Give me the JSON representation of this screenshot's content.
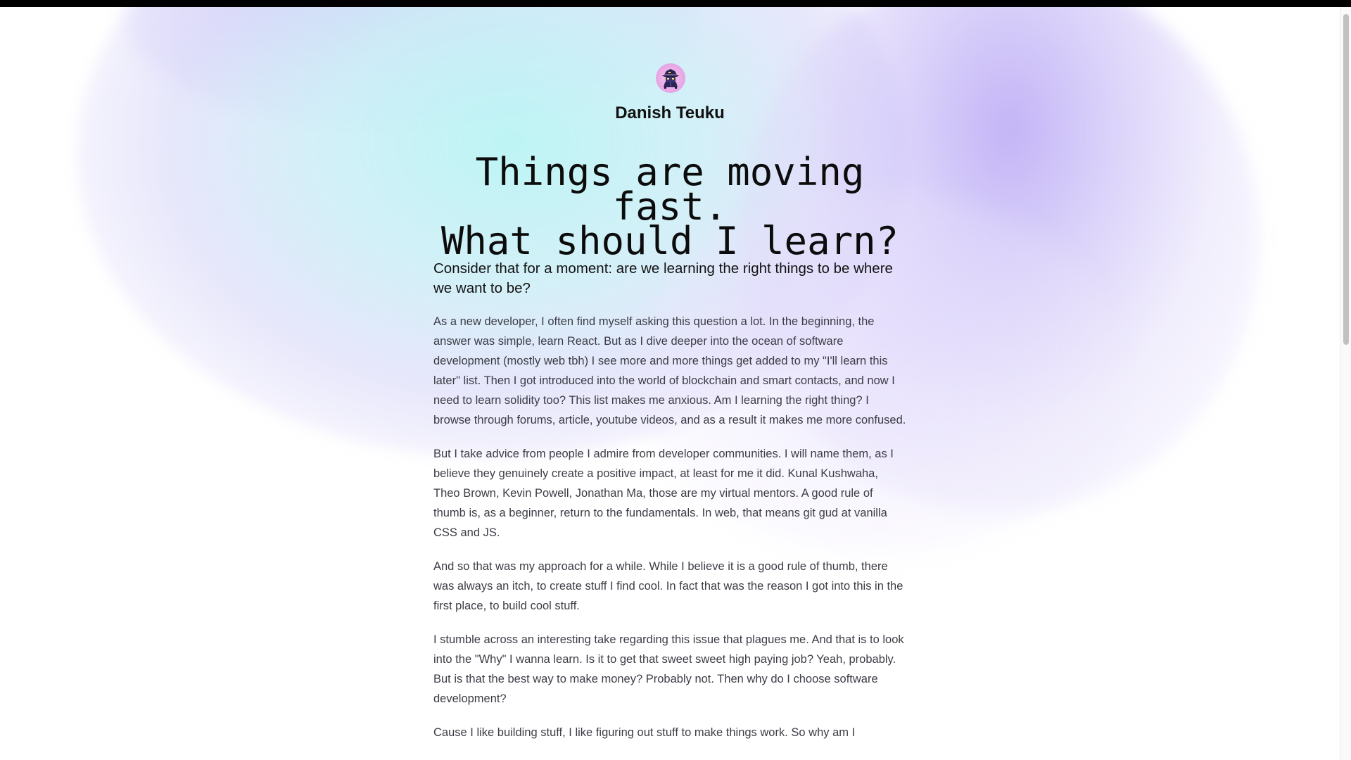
{
  "author": {
    "name": "Danish Teuku",
    "avatar_icon": "wizard-avatar-icon"
  },
  "article": {
    "title_line1": "Things are moving fast.",
    "title_line2": "What should I learn?",
    "subtitle": "Consider that for a moment: are we learning the right things to be where we want to be?",
    "paragraphs": [
      "As a new developer, I often find myself asking this question a lot. In the beginning, the answer was simple, learn React. But as I dive deeper into the ocean of software development (mostly web tbh) I see more and more things get added to my \"I'll learn this later\" list. Then I got introduced into the world of blockchain and smart contacts, and now I need to learn solidity too? This list makes me anxious. Am I learning the right thing? I browse through forums, article, youtube videos, and as a result it makes me more confused.",
      "But I take advice from people I admire from developer communities. I will name them, as I believe they genuinely create a positive impact, at least for me it did. Kunal Kushwaha, Theo Brown, Kevin Powell, Jonathan Ma, those are my virtual mentors. A good rule of thumb is, as a beginner, return to the fundamentals. In web, that means git gud at vanilla CSS and JS.",
      "And so that was my approach for a while. While I believe it is a good rule of thumb, there was always an itch, to create stuff I find cool. In fact that was the reason I got into this in the first place, to build cool stuff.",
      "I stumble across an interesting take regarding this issue that plagues me. And that is to look into the \"Why\" I wanna learn. Is it to get that sweet sweet high paying job? Yeah, probably. But is that the best way to make money? Probably not. Then why do I choose software development?",
      "Cause I like building stuff, I like figuring out stuff to make things work. So why am I"
    ]
  },
  "colors": {
    "background": "#ffffff",
    "glow_cyan": "#baf4f4",
    "glow_violet": "#c0b0f6",
    "avatar_bg": "#e9a8e6",
    "heading": "#0c0c0c",
    "body_text": "#3c3c46"
  }
}
